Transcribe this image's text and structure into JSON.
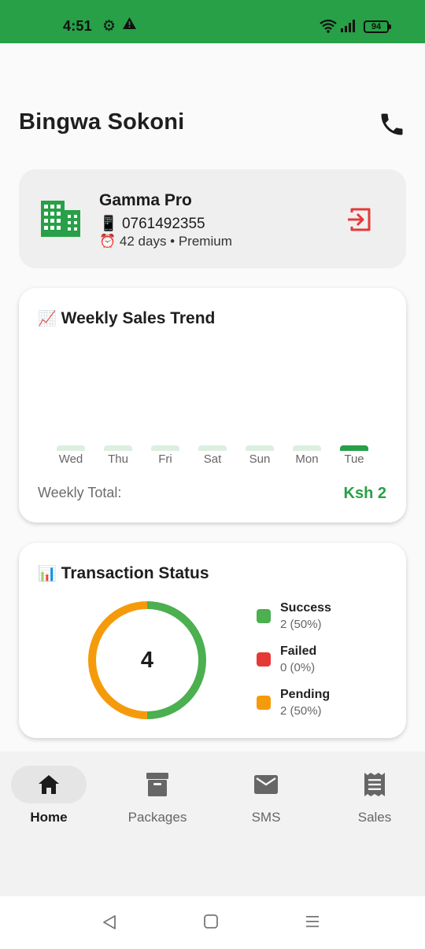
{
  "status_bar": {
    "time": "4:51",
    "battery": "94",
    "icons": [
      "gear-icon",
      "warning-icon",
      "wifi-icon",
      "signal-icon",
      "battery-icon"
    ]
  },
  "header": {
    "title": "Bingwa Sokoni",
    "call_icon": "phone-icon"
  },
  "profile": {
    "name": "Gamma Pro",
    "phone_emoji": "📱",
    "phone": "0761492355",
    "alarm_emoji": "⏰",
    "subscription": "42 days • Premium",
    "building_icon": "building-icon",
    "logout_icon": "logout-icon"
  },
  "sales_trend": {
    "emoji": "📈",
    "title": "Weekly Sales Trend",
    "weekly_total_label": "Weekly Total:",
    "weekly_total_value": "Ksh 2"
  },
  "chart_data": {
    "type": "bar",
    "categories": [
      "Wed",
      "Thu",
      "Fri",
      "Sat",
      "Sun",
      "Mon",
      "Tue"
    ],
    "values": [
      0,
      0,
      0,
      0,
      0,
      0,
      2
    ],
    "title": "Weekly Sales Trend"
  },
  "transaction_status": {
    "emoji": "📊",
    "title": "Transaction Status",
    "total": "4",
    "items": [
      {
        "name": "Success",
        "value": "2 (50%)",
        "fraction": 0.5,
        "color": "#4caf50"
      },
      {
        "name": "Failed",
        "value": "0 (0%)",
        "fraction": 0,
        "color": "#e53935"
      },
      {
        "name": "Pending",
        "value": "2 (50%)",
        "fraction": 0.5,
        "color": "#f59b0b"
      }
    ]
  },
  "bottom_nav": {
    "items": [
      {
        "label": "Home",
        "icon": "home-icon",
        "active": true
      },
      {
        "label": "Packages",
        "icon": "archive-icon",
        "active": false
      },
      {
        "label": "SMS",
        "icon": "mail-icon",
        "active": false
      },
      {
        "label": "Sales",
        "icon": "receipt-icon",
        "active": false
      }
    ]
  },
  "colors": {
    "accent": "#27a047",
    "logout": "#e53935"
  }
}
